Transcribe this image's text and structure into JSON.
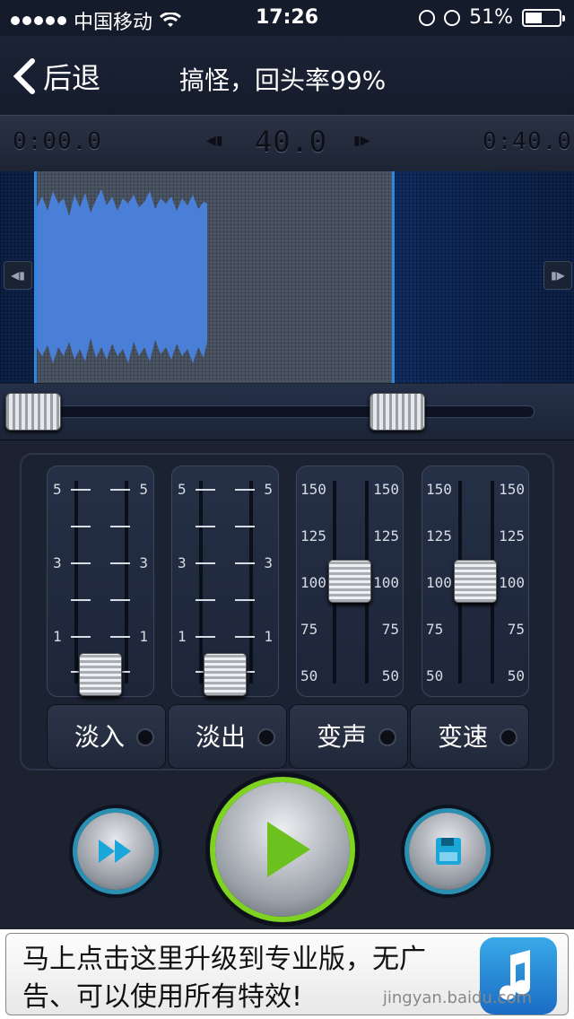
{
  "status_bar": {
    "carrier": "中国移动",
    "time": "17:26",
    "battery": "51%",
    "battery_level": 0.51
  },
  "nav": {
    "back_label": "后退",
    "title": "搞怪，回头率99%"
  },
  "timebar": {
    "start": "0:00.0",
    "duration": "40.0",
    "end": "0:40.0"
  },
  "faders": [
    {
      "labels": [
        "5",
        "3",
        "1"
      ]
    },
    {
      "labels": [
        "5",
        "3",
        "1"
      ]
    },
    {
      "labels": [
        "150",
        "125",
        "100",
        "75",
        "50"
      ]
    },
    {
      "labels": [
        "150",
        "125",
        "100",
        "75",
        "50"
      ]
    }
  ],
  "tabs": [
    {
      "label": "淡入"
    },
    {
      "label": "淡出"
    },
    {
      "label": "变声"
    },
    {
      "label": "变速"
    }
  ],
  "ad": {
    "text": "马上点击这里升级到专业版，无广告、可以使用所有特效!",
    "watermark": "jingyan.baidu.com"
  },
  "colors": {
    "accent_blue": "#2f86e0",
    "play_ring": "#7ed321",
    "button_ring": "#2a8fb0",
    "waveform": "#4a7fd8"
  }
}
